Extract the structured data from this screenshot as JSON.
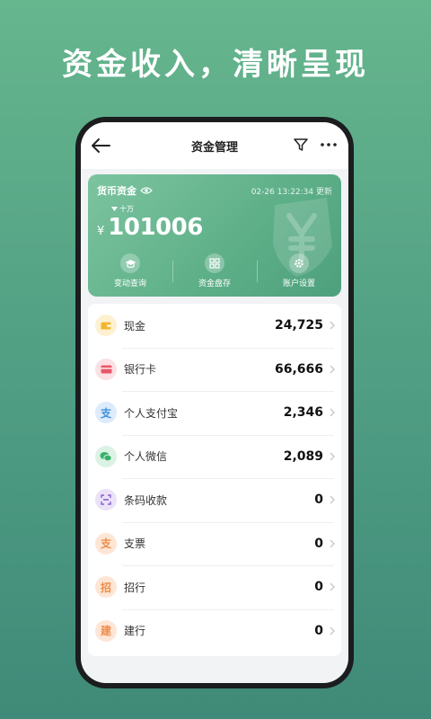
{
  "headline": "资金收入，清晰呈现",
  "navbar": {
    "title": "资金管理",
    "back_icon": "arrow-left-icon",
    "filter_icon": "filter-icon",
    "more_icon": "more-horizontal-icon"
  },
  "card": {
    "title": "货币资金",
    "time": "02-26 13:22:34 更新",
    "unit": "十万",
    "currency": "¥",
    "amount": "101006",
    "actions": [
      {
        "label": "变动查询",
        "icon": "graduation-cap-icon"
      },
      {
        "label": "资金盘存",
        "icon": "grid-icon"
      },
      {
        "label": "账户设置",
        "icon": "gear-icon"
      }
    ]
  },
  "accounts": [
    {
      "label": "现金",
      "value": "24,725",
      "icon": "wallet-icon",
      "glyph": "",
      "color": "#f2b632",
      "bg": "#fdf1d2"
    },
    {
      "label": "银行卡",
      "value": "66,666",
      "icon": "bank-card-icon",
      "glyph": "",
      "color": "#e8576a",
      "bg": "#fbe0e4"
    },
    {
      "label": "个人支付宝",
      "value": "2,346",
      "icon": "alipay-icon",
      "glyph": "支",
      "color": "#3b8fe0",
      "bg": "#ddebfa"
    },
    {
      "label": "个人微信",
      "value": "2,089",
      "icon": "wechat-icon",
      "glyph": "",
      "color": "#36b26b",
      "bg": "#dcf2e5"
    },
    {
      "label": "条码收款",
      "value": "0",
      "icon": "barcode-scan-icon",
      "glyph": "",
      "color": "#8c5fd0",
      "bg": "#ebe2f7"
    },
    {
      "label": "支票",
      "value": "0",
      "icon": "cheque-icon",
      "glyph": "支",
      "color": "#ee8c4a",
      "bg": "#fde6d6"
    },
    {
      "label": "招行",
      "value": "0",
      "icon": "cmb-bank-icon",
      "glyph": "招",
      "color": "#ee8c4a",
      "bg": "#fde6d6"
    },
    {
      "label": "建行",
      "value": "0",
      "icon": "ccb-bank-icon",
      "glyph": "建",
      "color": "#ee8c4a",
      "bg": "#fde6d6"
    }
  ]
}
